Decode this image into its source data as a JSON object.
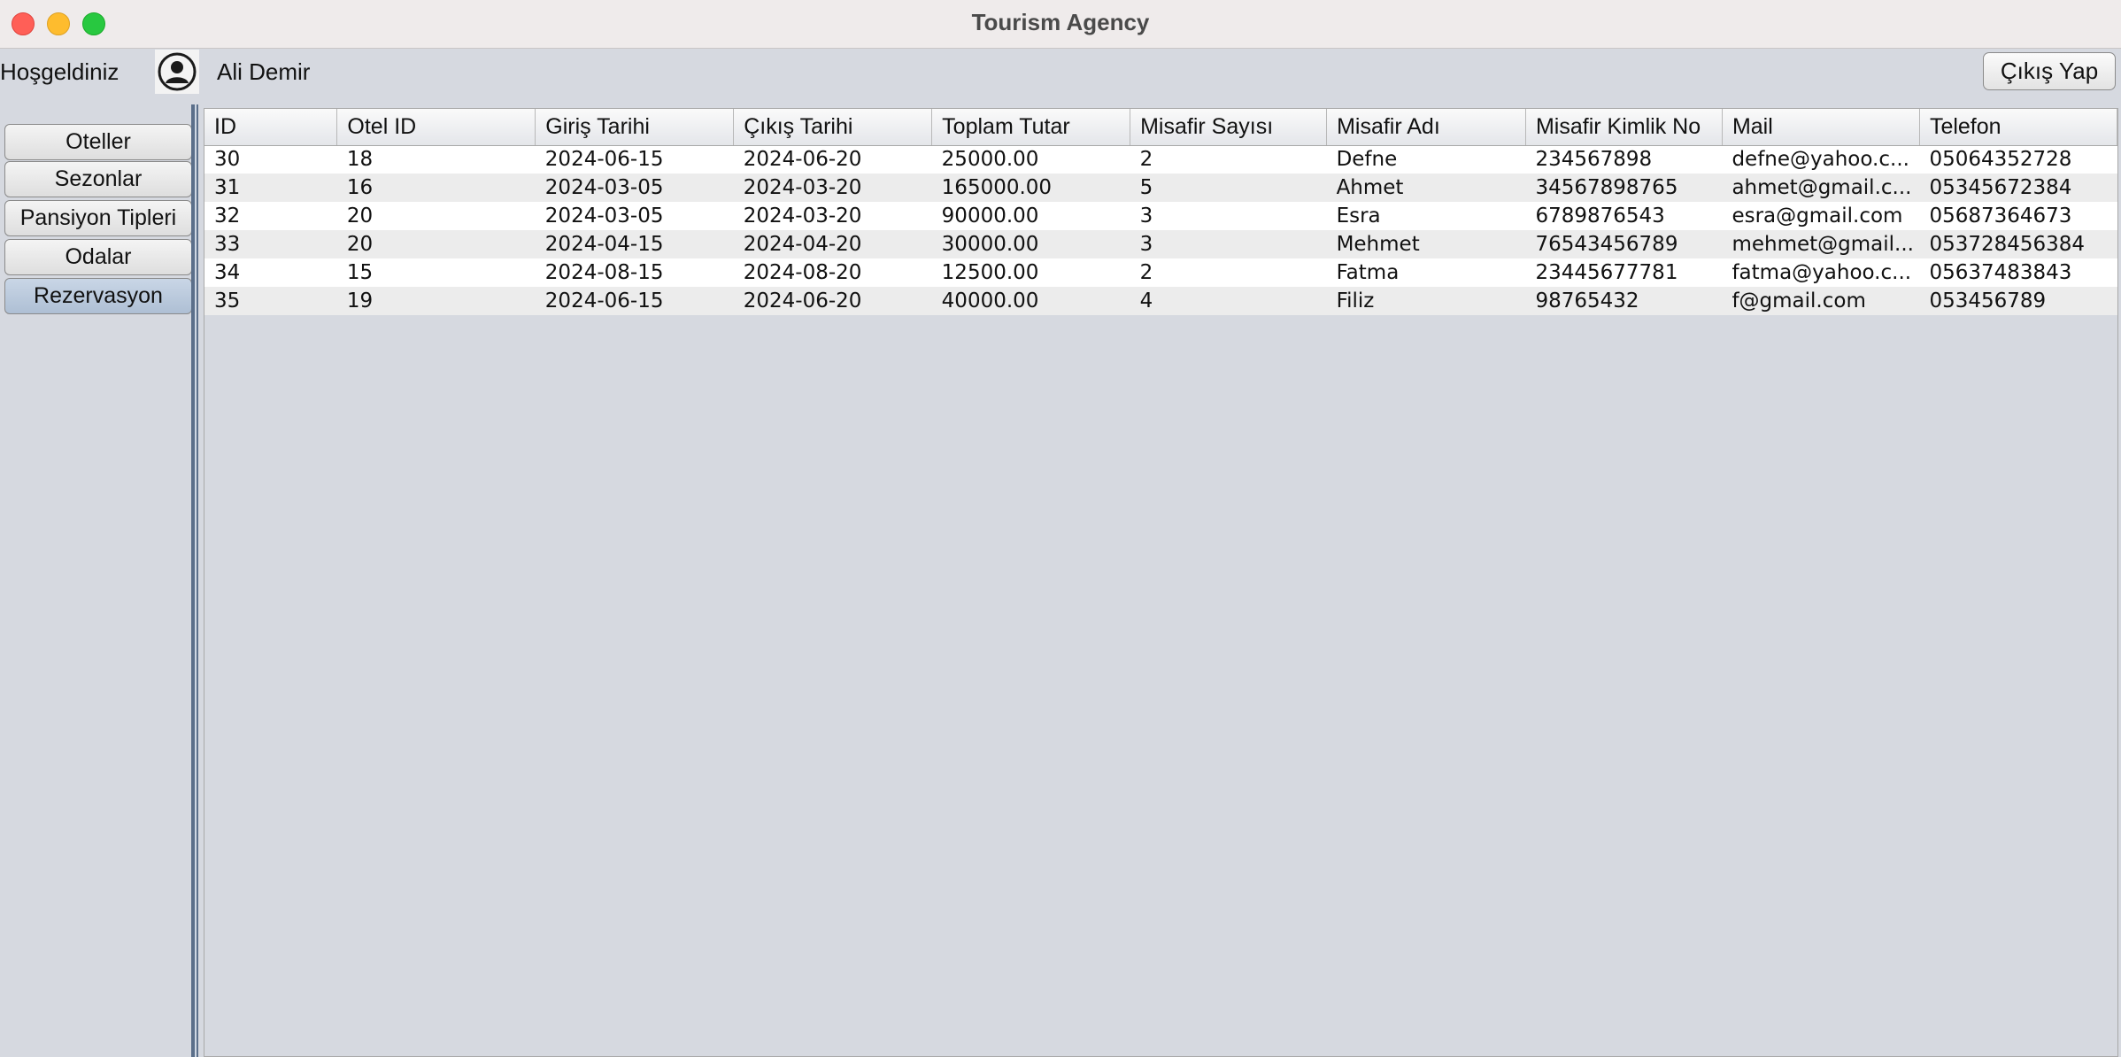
{
  "window": {
    "title": "Tourism Agency"
  },
  "header": {
    "welcome_label": "Hoşgeldiniz",
    "user_name": "Ali Demir",
    "logout_label": "Çıkış Yap"
  },
  "sidebar": {
    "items": [
      {
        "label": "Oteller"
      },
      {
        "label": "Sezonlar"
      },
      {
        "label": "Pansiyon Tipleri"
      },
      {
        "label": "Odalar"
      },
      {
        "label": "Rezervasyon"
      }
    ],
    "active_index": 4
  },
  "table": {
    "columns": [
      "ID",
      "Otel ID",
      "Giriş Tarihi",
      "Çıkış Tarihi",
      "Toplam Tutar",
      "Misafir Sayısı",
      "Misafir Adı",
      "Misafir Kimlik No",
      "Mail",
      "Telefon"
    ],
    "rows": [
      [
        "30",
        "18",
        "2024-06-15",
        "2024-06-20",
        "25000.00",
        "2",
        "Defne",
        "234567898",
        "defne@yahoo.c...",
        "05064352728"
      ],
      [
        "31",
        "16",
        "2024-03-05",
        "2024-03-20",
        "165000.00",
        "5",
        "Ahmet",
        "34567898765",
        "ahmet@gmail.c...",
        "05345672384"
      ],
      [
        "32",
        "20",
        "2024-03-05",
        "2024-03-20",
        "90000.00",
        "3",
        "Esra",
        "6789876543",
        "esra@gmail.com",
        "05687364673"
      ],
      [
        "33",
        "20",
        "2024-04-15",
        "2024-04-20",
        "30000.00",
        "3",
        "Mehmet",
        "76543456789",
        "mehmet@gmail...",
        "053728456384"
      ],
      [
        "34",
        "15",
        "2024-08-15",
        "2024-08-20",
        "12500.00",
        "2",
        "Fatma",
        "23445677781",
        "fatma@yahoo.c...",
        "05637483843"
      ],
      [
        "35",
        "19",
        "2024-06-15",
        "2024-06-20",
        "40000.00",
        "4",
        "Filiz",
        "98765432",
        "f@gmail.com",
        "053456789"
      ]
    ]
  },
  "colors": {
    "background": "#d6d9e0",
    "active_nav": "#b7c7db",
    "divider": "#5b6f8a"
  }
}
